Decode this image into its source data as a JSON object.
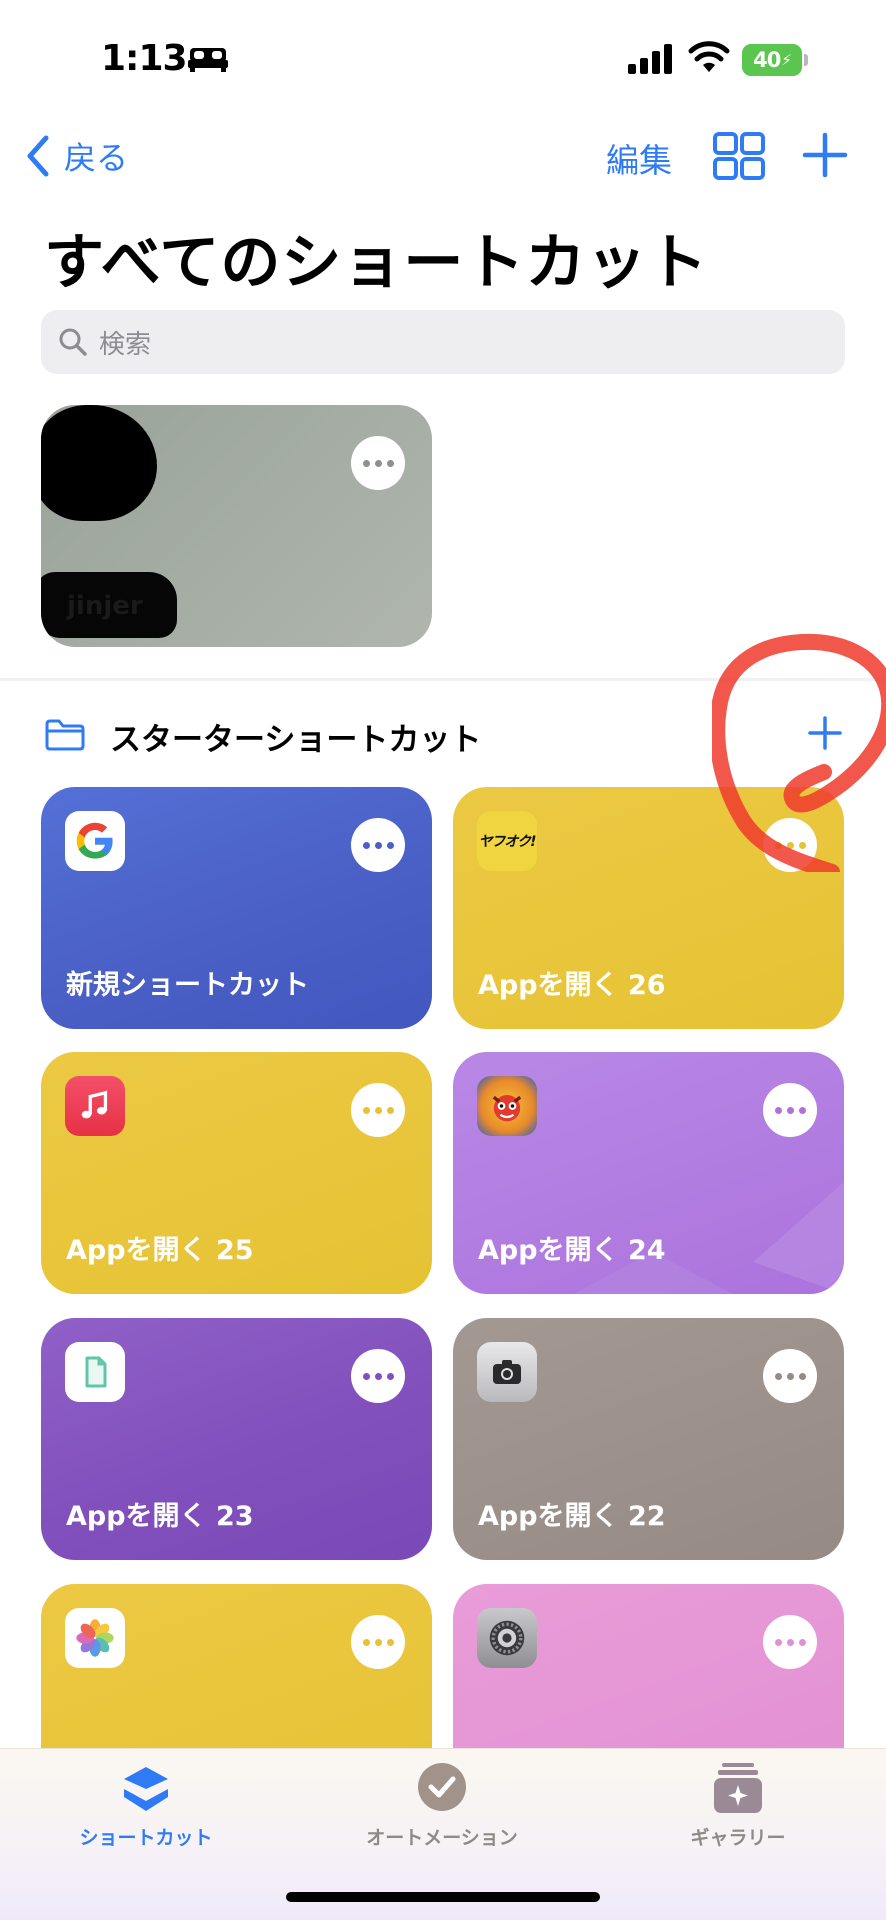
{
  "status": {
    "time": "1:13",
    "battery": "40"
  },
  "nav": {
    "back_label": "戻る",
    "edit_label": "編集"
  },
  "title": "すべてのショートカット",
  "search": {
    "placeholder": "検索"
  },
  "top_shortcut": {
    "label": "jinjer"
  },
  "section": {
    "title": "スターターショートカット"
  },
  "tiles": [
    {
      "label": "新規ショートカット",
      "icon": "google-icon",
      "color": "#4a60c6"
    },
    {
      "label": "Appを開く 26",
      "icon": "yafuoku-icon",
      "color": "#e8c43a"
    },
    {
      "label": "Appを開く 25",
      "icon": "music-icon",
      "color": "#e8c43a"
    },
    {
      "label": "Appを開く 24",
      "icon": "monster-strike-icon",
      "color": "#b07ce0"
    },
    {
      "label": "Appを開く 23",
      "icon": "files-icon",
      "color": "#8b59c2"
    },
    {
      "label": "Appを開く 22",
      "icon": "camera-icon",
      "color": "#9d918a"
    },
    {
      "label": "",
      "icon": "photos-icon",
      "color": "#e8c43a"
    },
    {
      "label": "",
      "icon": "settings-icon",
      "color": "#e493d6"
    }
  ],
  "yafuoku_logo_text": "ヤフオク!",
  "tabs": [
    {
      "label": "ショートカット",
      "color": "#2f7bf5"
    },
    {
      "label": "オートメーション",
      "color": "#8e8a86"
    },
    {
      "label": "ギャラリー",
      "color": "#8e8a86"
    }
  ]
}
